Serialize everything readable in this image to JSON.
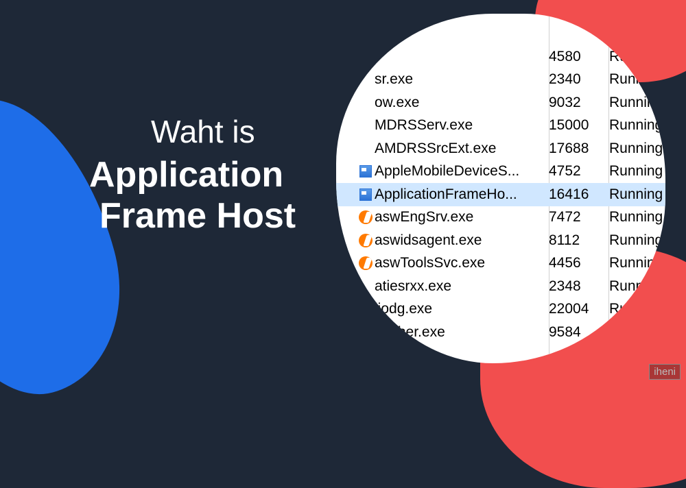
{
  "title": {
    "line1": "Waht is",
    "line2": "Application",
    "line3": "Frame Host"
  },
  "colors": {
    "background": "#1e2837",
    "blue": "#1e6de8",
    "red": "#f24e4e",
    "selected_row": "#d0e7ff"
  },
  "processes": [
    {
      "icon": "none",
      "name": "",
      "pid": "4580",
      "status": "Runni",
      "selected": false
    },
    {
      "icon": "none",
      "name": "sr.exe",
      "pid": "2340",
      "status": "Running",
      "selected": false
    },
    {
      "icon": "none",
      "name": "ow.exe",
      "pid": "9032",
      "status": "Running",
      "selected": false
    },
    {
      "icon": "none",
      "name": "MDRSServ.exe",
      "pid": "15000",
      "status": "Running",
      "selected": false
    },
    {
      "icon": "none",
      "name": "AMDRSSrcExt.exe",
      "pid": "17688",
      "status": "Running",
      "selected": false
    },
    {
      "icon": "win",
      "name": "AppleMobileDeviceS...",
      "pid": "4752",
      "status": "Running",
      "selected": false
    },
    {
      "icon": "win",
      "name": "ApplicationFrameHo...",
      "pid": "16416",
      "status": "Running",
      "selected": true
    },
    {
      "icon": "avast",
      "name": "aswEngSrv.exe",
      "pid": "7472",
      "status": "Running",
      "selected": false
    },
    {
      "icon": "avast",
      "name": "aswidsagent.exe",
      "pid": "8112",
      "status": "Running",
      "selected": false
    },
    {
      "icon": "avast",
      "name": "aswToolsSvc.exe",
      "pid": "4456",
      "status": "Running",
      "selected": false
    },
    {
      "icon": "none",
      "name": "atiesrxx.exe",
      "pid": "2348",
      "status": "Runnin",
      "selected": false
    },
    {
      "icon": "none",
      "name": "liodg.exe",
      "pid": "22004",
      "status": "Ru",
      "selected": false
    },
    {
      "icon": "none",
      "name": "uncher.exe",
      "pid": "9584",
      "status": "",
      "selected": false
    }
  ],
  "watermark": "iheni"
}
